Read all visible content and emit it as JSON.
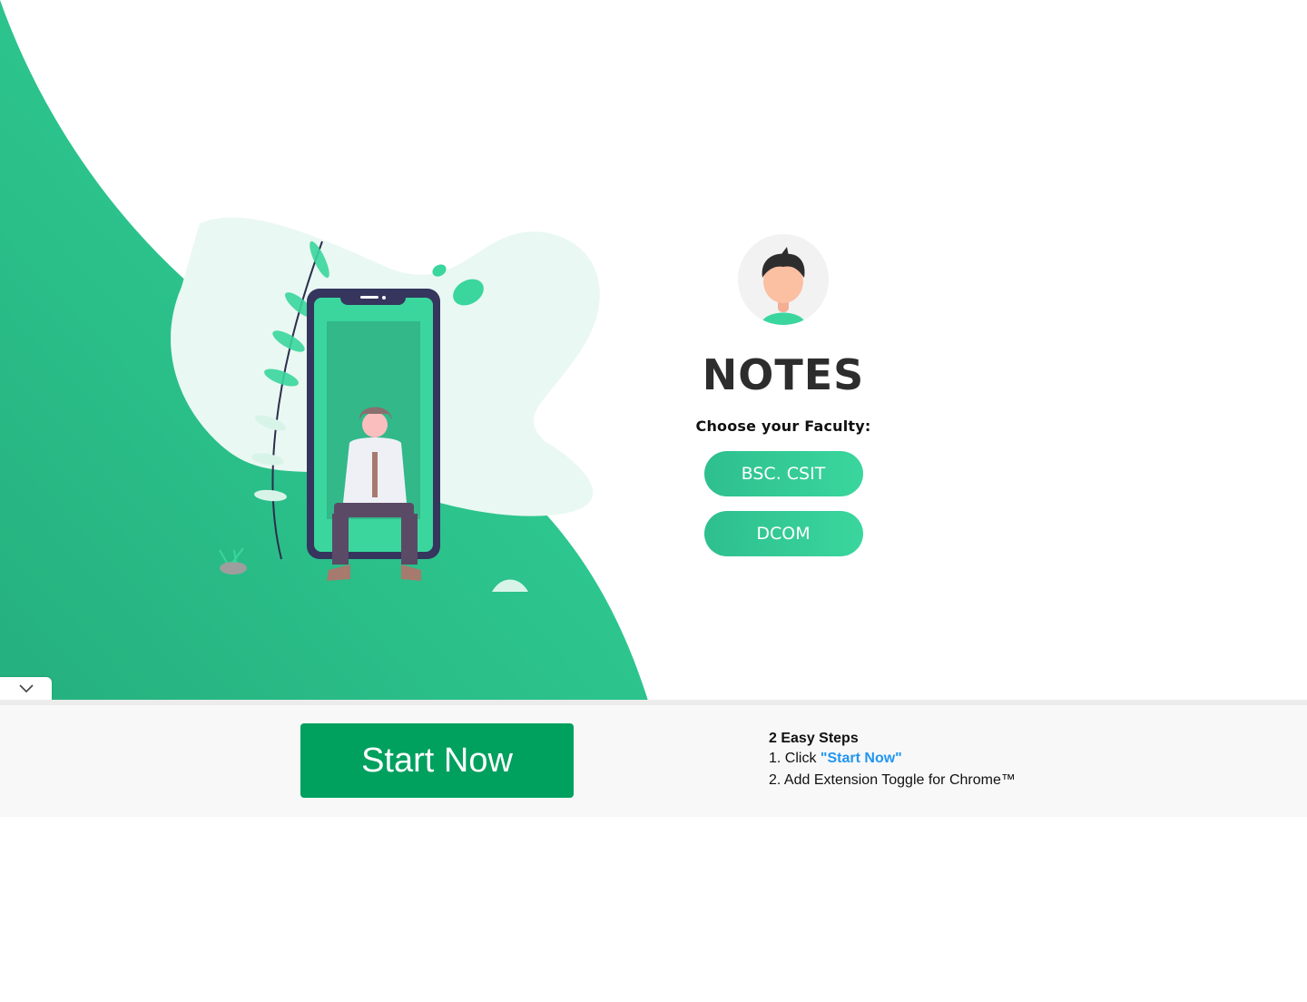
{
  "brand": {
    "title": "NOTES",
    "accent": "#2ecc94",
    "accent_dark": "#00a05e",
    "link_color": "#2196f3"
  },
  "panel": {
    "avatar_icon": "user-avatar-icon",
    "subtitle": "Choose your Faculty:",
    "faculties": [
      {
        "label": "BSC. CSIT"
      },
      {
        "label": "DCOM"
      }
    ]
  },
  "collapse": {
    "icon": "chevron-down-icon"
  },
  "ad": {
    "start_label": "Start Now",
    "steps_heading": "2 Easy Steps",
    "step1_prefix": "1. Click ",
    "step1_link": "\"Start Now\"",
    "step2": "2. Add Extension Toggle for Chrome™"
  }
}
